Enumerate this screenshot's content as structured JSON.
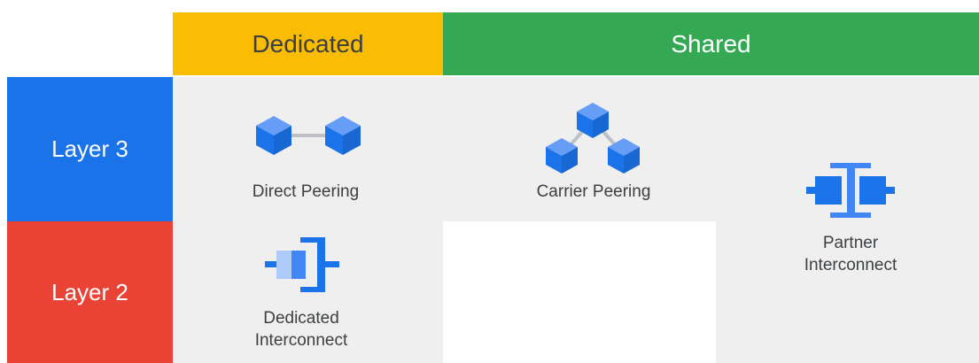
{
  "columns": {
    "dedicated": "Dedicated",
    "shared": "Shared"
  },
  "rows": {
    "layer3": "Layer 3",
    "layer2": "Layer 2"
  },
  "products": {
    "direct_peering": "Direct Peering",
    "carrier_peering": "Carrier Peering",
    "partner_interconnect_line1": "Partner",
    "partner_interconnect_line2": "Interconnect",
    "dedicated_interconnect_line1": "Dedicated",
    "dedicated_interconnect_line2": "Interconnect"
  },
  "icons": {
    "direct_peering": "two-cubes-linked-icon",
    "carrier_peering": "three-cubes-network-icon",
    "partner_interconnect": "partner-interconnect-icon",
    "dedicated_interconnect": "dedicated-interconnect-icon"
  },
  "colors": {
    "dedicated_header": "#fbbc04",
    "shared_header": "#34a853",
    "layer3": "#1a73e8",
    "layer2": "#ea4335",
    "panel": "#efefef",
    "icon_blue": "#1a73e8",
    "icon_light": "#aecbfa"
  }
}
